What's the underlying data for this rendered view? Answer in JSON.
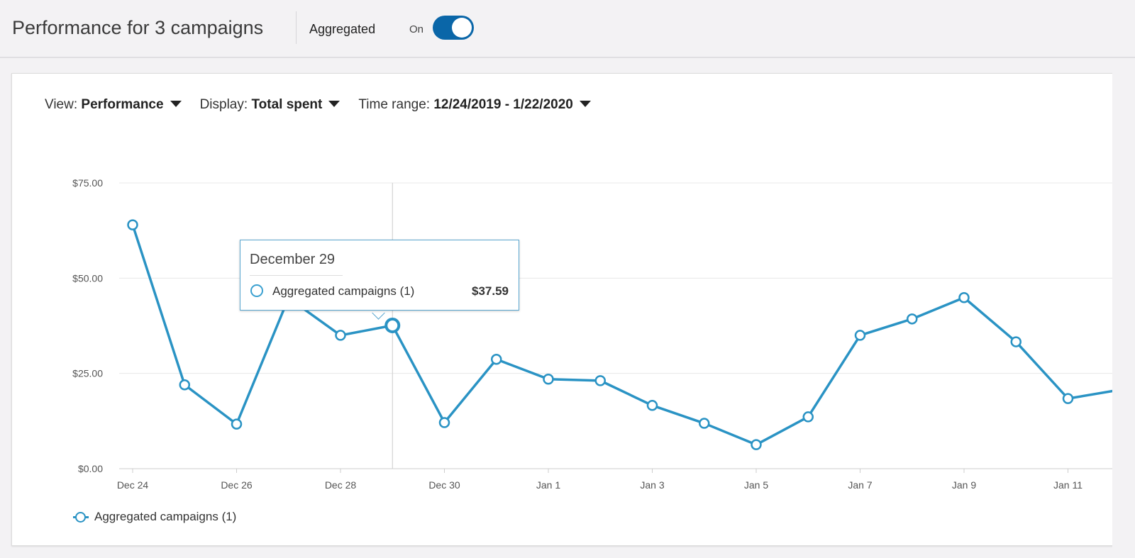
{
  "header": {
    "title": "Performance for 3 campaigns",
    "aggregated_label": "Aggregated",
    "toggle_state": "On"
  },
  "filters": {
    "view_label": "View:",
    "view_value": "Performance",
    "display_label": "Display:",
    "display_value": "Total spent",
    "time_label": "Time range:",
    "time_value": "12/24/2019 - 1/22/2020"
  },
  "tooltip": {
    "date": "December 29",
    "series": "Aggregated campaigns (1)",
    "value": "$37.59"
  },
  "legend": {
    "label": "Aggregated campaigns (1)"
  },
  "colors": {
    "line": "#2a93c4",
    "toggle": "#0a66a8"
  },
  "chart_data": {
    "type": "line",
    "ylim": [
      0,
      75
    ],
    "yticks": [
      "$0.00",
      "$25.00",
      "$50.00",
      "$75.00"
    ],
    "ytick_values": [
      0,
      25,
      50,
      75
    ],
    "x": [
      "Dec 24",
      "Dec 25",
      "Dec 26",
      "Dec 27",
      "Dec 28",
      "Dec 29",
      "Dec 30",
      "Dec 31",
      "Jan 1",
      "Jan 2",
      "Jan 3",
      "Jan 4",
      "Jan 5",
      "Jan 6",
      "Jan 7",
      "Jan 8",
      "Jan 9",
      "Jan 10",
      "Jan 11",
      "Jan 12"
    ],
    "xticks": [
      "Dec 24",
      "Dec 26",
      "Dec 28",
      "Dec 30",
      "Jan 1",
      "Jan 3",
      "Jan 5",
      "Jan 7",
      "Jan 9",
      "Jan 11"
    ],
    "series": [
      {
        "name": "Aggregated campaigns (1)",
        "values": [
          64.0,
          22.0,
          11.7,
          44.8,
          35.0,
          37.59,
          12.1,
          28.7,
          23.5,
          23.1,
          16.6,
          11.9,
          6.3,
          13.6,
          35.0,
          39.3,
          44.9,
          33.3,
          18.4,
          20.7
        ]
      }
    ],
    "highlight_index": 5,
    "grid": true
  }
}
